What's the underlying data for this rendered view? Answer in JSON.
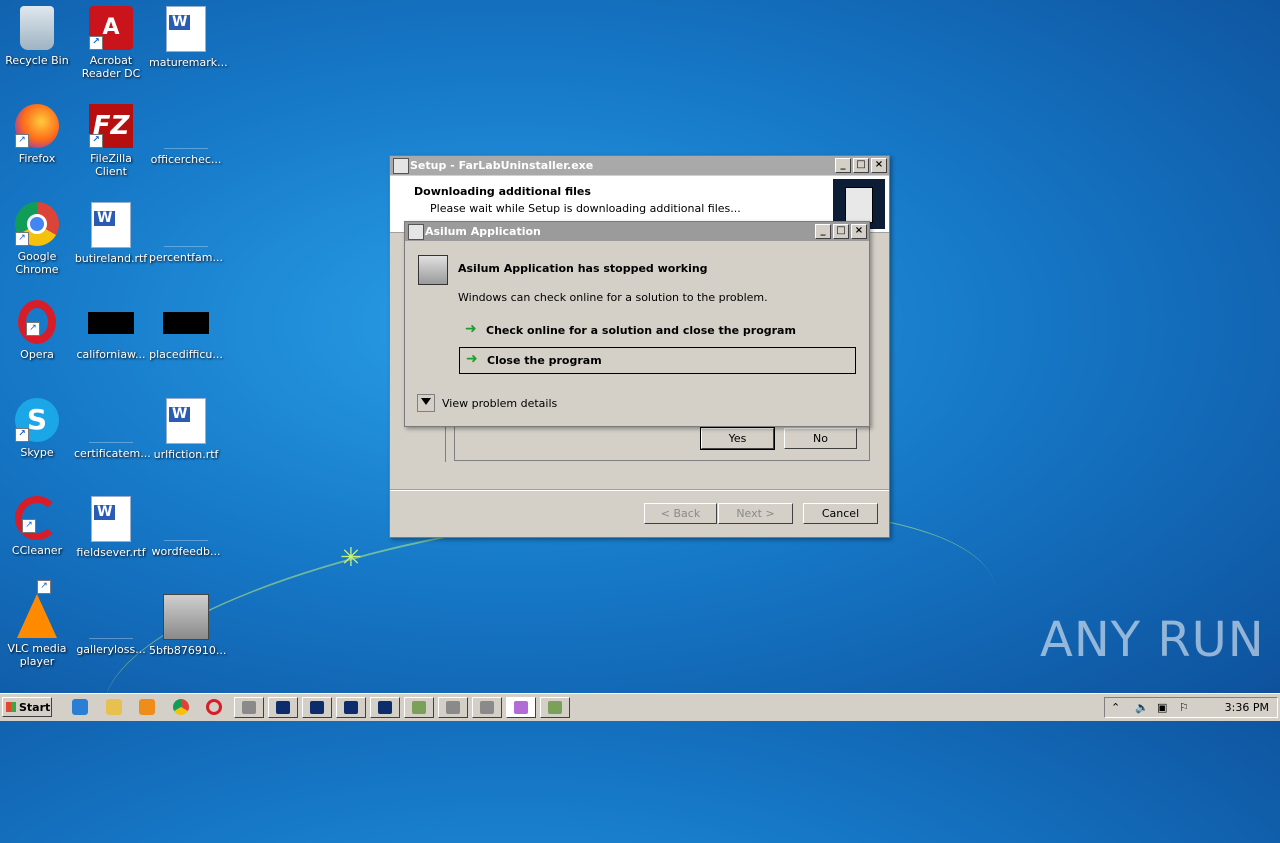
{
  "desktop": {
    "icons": [
      {
        "label": "Recycle Bin",
        "icon": "recycle-bin-icon"
      },
      {
        "label": "Acrobat Reader DC",
        "icon": "acrobat-icon"
      },
      {
        "label": "maturemark...",
        "icon": "word-doc-icon"
      },
      {
        "label": "Firefox",
        "icon": "firefox-icon"
      },
      {
        "label": "FileZilla Client",
        "icon": "filezilla-icon"
      },
      {
        "label": "officerchec...",
        "icon": "blank-file-icon"
      },
      {
        "label": "Google Chrome",
        "icon": "chrome-icon"
      },
      {
        "label": "butireland.rtf",
        "icon": "word-doc-icon"
      },
      {
        "label": "percentfam...",
        "icon": "blank-file-icon"
      },
      {
        "label": "Opera",
        "icon": "opera-icon"
      },
      {
        "label": "californiaw...",
        "icon": "black-file-icon"
      },
      {
        "label": "placedifficu...",
        "icon": "black-file-icon"
      },
      {
        "label": "Skype",
        "icon": "skype-icon"
      },
      {
        "label": "certificatem...",
        "icon": "blank-file-icon"
      },
      {
        "label": "urlfiction.rtf",
        "icon": "word-doc-icon"
      },
      {
        "label": "CCleaner",
        "icon": "ccleaner-icon"
      },
      {
        "label": "fieldsever.rtf",
        "icon": "word-doc-icon"
      },
      {
        "label": "wordfeedb...",
        "icon": "blank-file-icon"
      },
      {
        "label": "VLC media player",
        "icon": "vlc-icon"
      },
      {
        "label": "galleryloss...",
        "icon": "blank-file-icon"
      },
      {
        "label": "5bfb876910...",
        "icon": "installer-icon"
      }
    ]
  },
  "setup_window": {
    "title": "Setup - FarLabUninstaller.exe",
    "heading": "Downloading additional files",
    "subheading": "Please wait while Setup is downloading additional files...",
    "yes_label": "Yes",
    "no_label": "No",
    "back_label": "< Back",
    "next_label": "Next >",
    "cancel_label": "Cancel"
  },
  "error_dialog": {
    "title": "Asilum Application",
    "heading": "Asilum Application has stopped working",
    "message": "Windows can check online for a solution to the problem.",
    "option_check_online": "Check online for a solution and close the program",
    "option_close": "Close the program",
    "details_label": "View problem details"
  },
  "taskbar": {
    "start_label": "Start",
    "clock": "3:36 PM"
  },
  "watermark": "ANY RUN"
}
